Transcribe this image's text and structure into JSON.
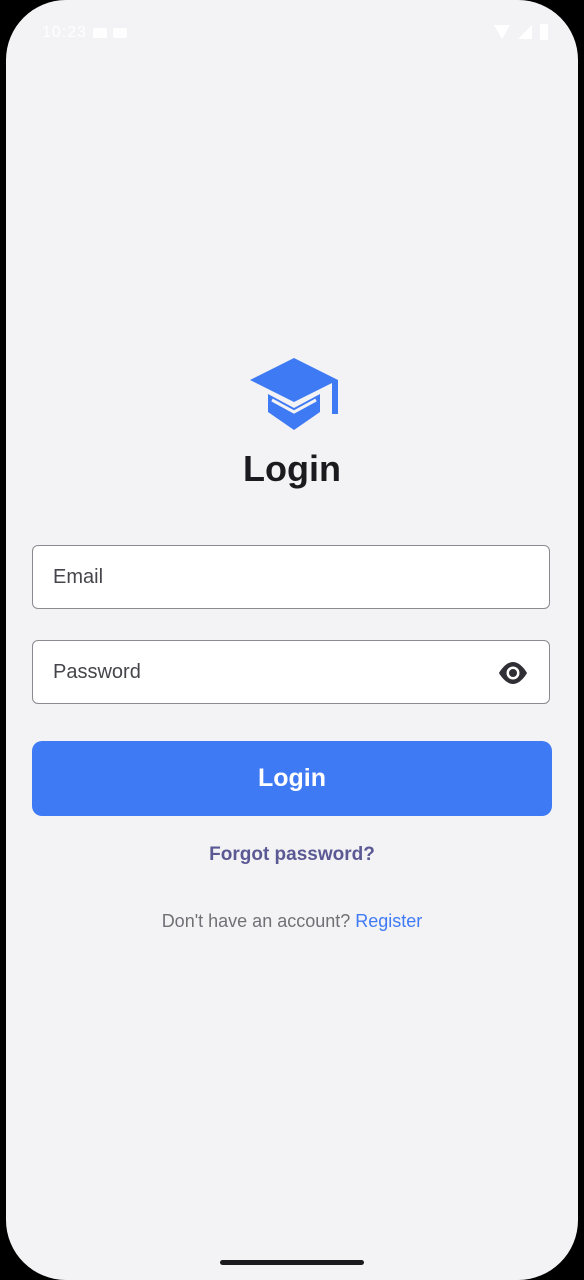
{
  "status_bar": {
    "time": "10:23"
  },
  "login": {
    "title": "Login",
    "email_placeholder": "Email",
    "password_placeholder": "Password",
    "login_button_label": "Login",
    "forgot_password_label": "Forgot password?",
    "no_account_text": "Don't have an account? ",
    "register_label": "Register"
  },
  "icons": {
    "logo": "graduation-cap-icon",
    "password_toggle": "eye-icon"
  },
  "colors": {
    "accent": "#3f7af5",
    "forgot_link": "#5b5994",
    "background": "#f3f3f5"
  }
}
